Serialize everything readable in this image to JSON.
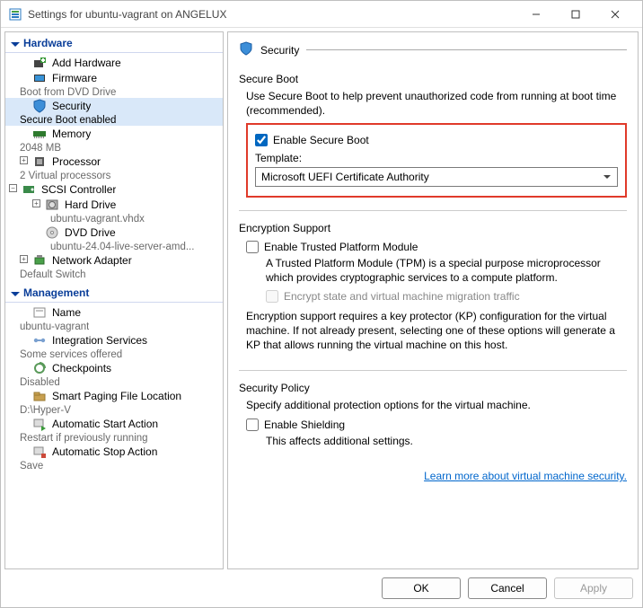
{
  "window": {
    "title": "Settings for ubuntu-vagrant on ANGELUX"
  },
  "sections": {
    "hardware": "Hardware",
    "management": "Management"
  },
  "tree": {
    "add_hardware": "Add Hardware",
    "firmware": "Firmware",
    "firmware_sub": "Boot from DVD Drive",
    "security": "Security",
    "security_sub": "Secure Boot enabled",
    "memory": "Memory",
    "memory_sub": "2048 MB",
    "processor": "Processor",
    "processor_sub": "2 Virtual processors",
    "scsi": "SCSI Controller",
    "hard_drive": "Hard Drive",
    "hard_drive_sub": "ubuntu-vagrant.vhdx",
    "dvd_drive": "DVD Drive",
    "dvd_drive_sub": "ubuntu-24.04-live-server-amd...",
    "net": "Network Adapter",
    "net_sub": "Default Switch",
    "name": "Name",
    "name_sub": "ubuntu-vagrant",
    "integration": "Integration Services",
    "integration_sub": "Some services offered",
    "checkpoints": "Checkpoints",
    "checkpoints_sub": "Disabled",
    "smart_paging": "Smart Paging File Location",
    "smart_paging_sub": "D:\\Hyper-V",
    "auto_start": "Automatic Start Action",
    "auto_start_sub": "Restart if previously running",
    "auto_stop": "Automatic Stop Action",
    "auto_stop_sub": "Save"
  },
  "pane": {
    "title": "Security",
    "secure_boot": {
      "group": "Secure Boot",
      "desc": "Use Secure Boot to help prevent unauthorized code from running at boot time (recommended).",
      "enable": "Enable Secure Boot",
      "template_label": "Template:",
      "template_value": "Microsoft UEFI Certificate Authority"
    },
    "encryption": {
      "group": "Encryption Support",
      "tpm": "Enable Trusted Platform Module",
      "tpm_desc": "A Trusted Platform Module (TPM) is a special purpose microprocessor which provides cryptographic services to a compute platform.",
      "encrypt_state": "Encrypt state and virtual machine migration traffic",
      "kp_desc": "Encryption support requires a key protector (KP) configuration for the virtual machine. If not already present, selecting one of these options will generate a KP that allows running the virtual machine on this host."
    },
    "policy": {
      "group": "Security Policy",
      "desc": "Specify additional protection options for the virtual machine.",
      "shielding": "Enable Shielding",
      "shielding_desc": "This affects additional settings."
    },
    "link": "Learn more about virtual machine security."
  },
  "buttons": {
    "ok": "OK",
    "cancel": "Cancel",
    "apply": "Apply"
  }
}
